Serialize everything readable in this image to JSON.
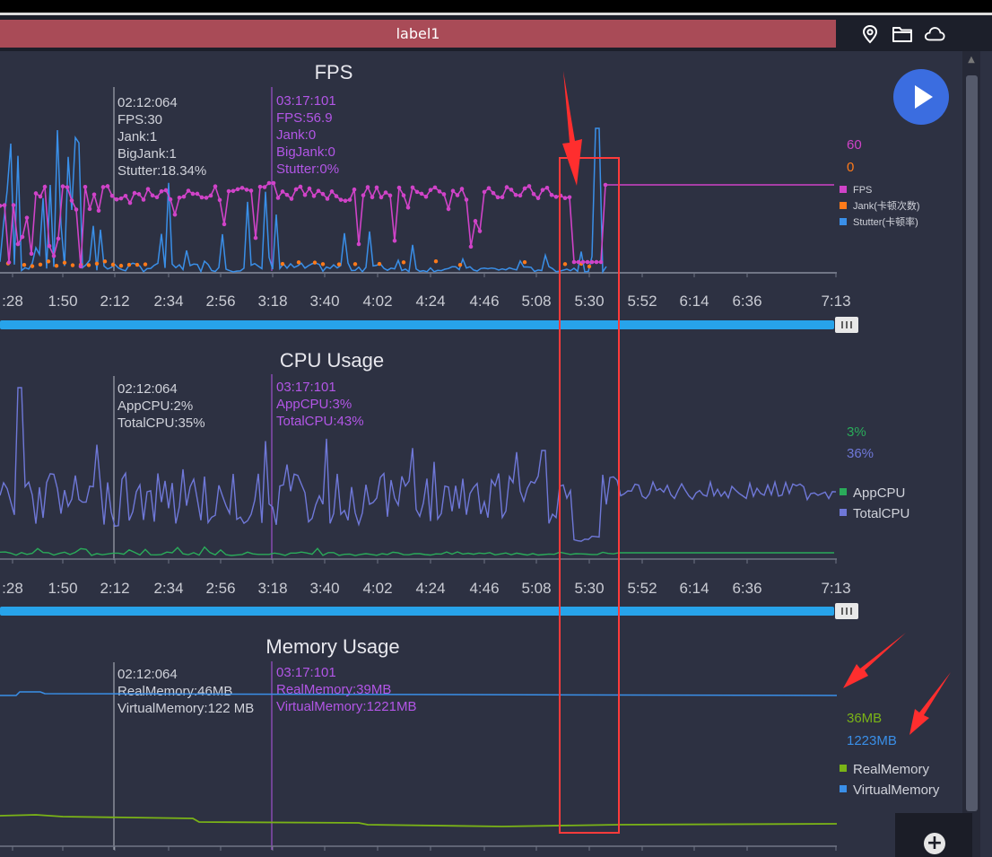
{
  "tab": {
    "label": "label1"
  },
  "toolbar": {
    "icons": [
      "location-icon",
      "folder-icon",
      "cloud-icon"
    ]
  },
  "x_ticks": [
    ":28",
    "1:50",
    "2:12",
    "2:34",
    "2:56",
    "3:18",
    "3:40",
    "4:02",
    "4:24",
    "4:46",
    "5:08",
    "5:30",
    "5:52",
    "6:14",
    "6:36",
    "7:13"
  ],
  "colors": {
    "fps": "#d043c8",
    "jank": "#ff7a1a",
    "stutter": "#3a8fe8",
    "app_cpu": "#2aab5a",
    "total_cpu": "#6f78d8",
    "real_mem": "#7ab317",
    "virtual_mem": "#3a8fe8",
    "cursor2": "#b256e6",
    "annotation": "#ff3b3b"
  },
  "fps": {
    "title": "FPS",
    "cursor1": {
      "time": "02:12:064",
      "lines": [
        "FPS:30",
        "Jank:1",
        "BigJank:1",
        "Stutter:18.34%"
      ]
    },
    "cursor2": {
      "time": "03:17:101",
      "lines": [
        "FPS:56.9",
        "Jank:0",
        "BigJank:0",
        "Stutter:0%"
      ]
    },
    "current": {
      "fps": "60",
      "jank": "0"
    },
    "legend": [
      "FPS",
      "Jank(卡顿次数)",
      "Stutter(卡顿率)"
    ]
  },
  "cpu": {
    "title": "CPU Usage",
    "cursor1": {
      "time": "02:12:064",
      "lines": [
        "AppCPU:2%",
        "TotalCPU:35%"
      ]
    },
    "cursor2": {
      "time": "03:17:101",
      "lines": [
        "AppCPU:3%",
        "TotalCPU:43%"
      ]
    },
    "current": {
      "app": "3%",
      "total": "36%"
    },
    "legend": [
      "AppCPU",
      "TotalCPU"
    ]
  },
  "memory": {
    "title": "Memory Usage",
    "cursor1": {
      "time": "02:12:064",
      "lines": [
        "RealMemory:46MB",
        "VirtualMemory:122 MB"
      ]
    },
    "cursor2": {
      "time": "03:17:101",
      "lines": [
        "RealMemory:39MB",
        "VirtualMemory:1221MB"
      ]
    },
    "current": {
      "real": "36MB",
      "virtual": "1223MB"
    },
    "legend": [
      "RealMemory",
      "VirtualMemory"
    ]
  }
}
